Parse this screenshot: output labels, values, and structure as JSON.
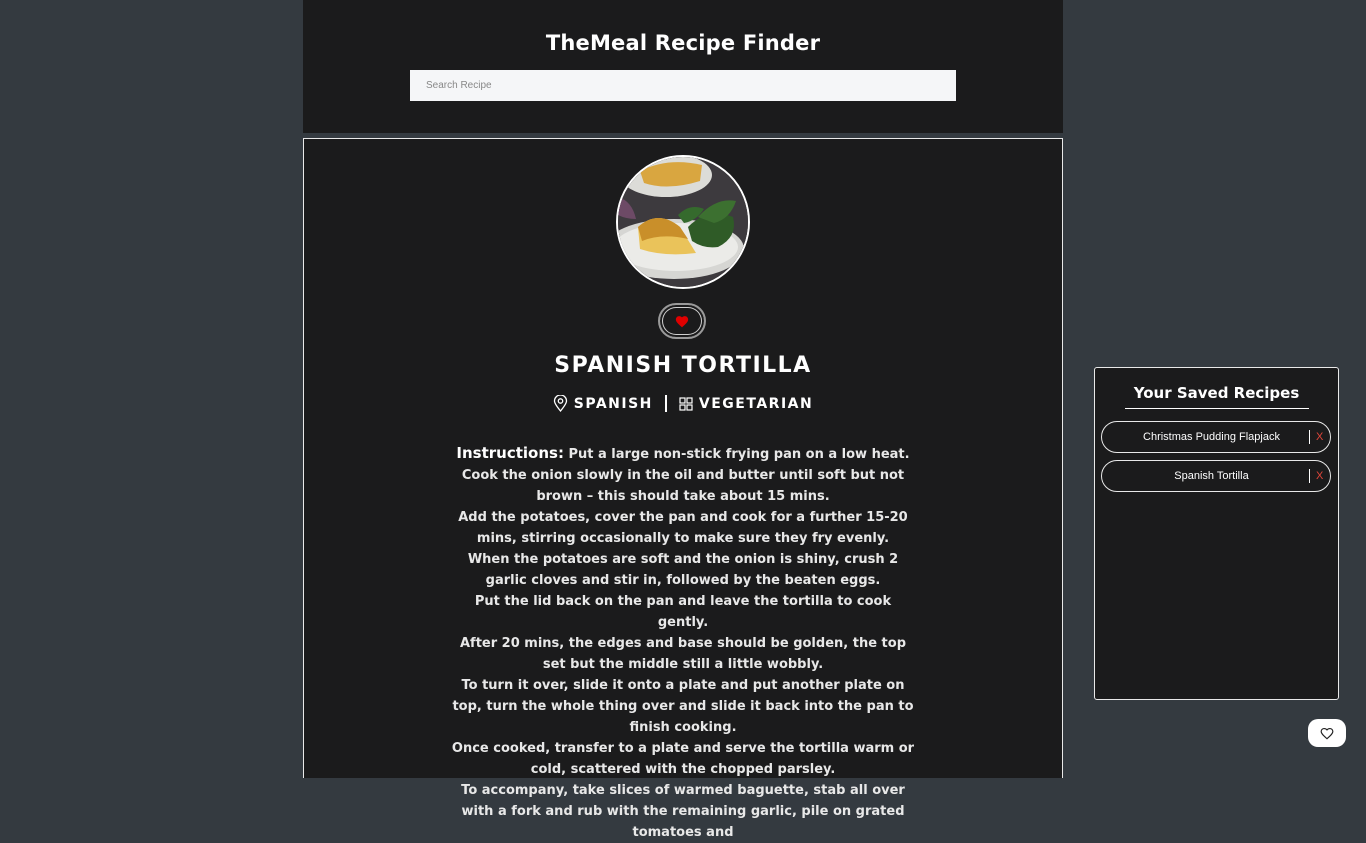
{
  "header": {
    "title": "TheMeal Recipe Finder",
    "search_placeholder": "Search Recipe"
  },
  "meal": {
    "name": "SPANISH TORTILLA",
    "area": "SPANISH",
    "category": "VEGETARIAN",
    "instructions_label": "Instructions:",
    "instructions_lines": [
      "Put a large non-stick frying pan on a low heat.",
      "Cook the onion slowly in the oil and butter until soft but not brown – this should take about 15 mins.",
      "Add the potatoes, cover the pan and cook for a further 15-20 mins, stirring occasionally to make sure they fry evenly.",
      "When the potatoes are soft and the onion is shiny, crush 2 garlic cloves and stir in, followed by the beaten eggs.",
      "Put the lid back on the pan and leave the tortilla to cook gently.",
      "After 20 mins, the edges and base should be golden, the top set but the middle still a little wobbly.",
      "To turn it over, slide it onto a plate and put another plate on top, turn the whole thing over and slide it back into the pan to finish cooking.",
      "Once cooked, transfer to a plate and serve the tortilla warm or cold, scattered with the chopped parsley.",
      "To accompany, take slices of warmed baguette, stab all over with a fork and rub with the remaining garlic, pile on grated tomatoes and"
    ],
    "favorite_icon": "heart-filled-icon",
    "favorite_color": "#e00000"
  },
  "saved": {
    "title": "Your Saved Recipes",
    "items": [
      {
        "name": "Christmas Pudding Flapjack",
        "remove_label": "X"
      },
      {
        "name": "Spanish Tortilla",
        "remove_label": "X"
      }
    ]
  },
  "floating_button": {
    "icon": "heart-outline-icon"
  },
  "colors": {
    "page_bg": "#343a40",
    "panel_bg": "#1b1b1c",
    "remove_red": "#e0453a"
  }
}
